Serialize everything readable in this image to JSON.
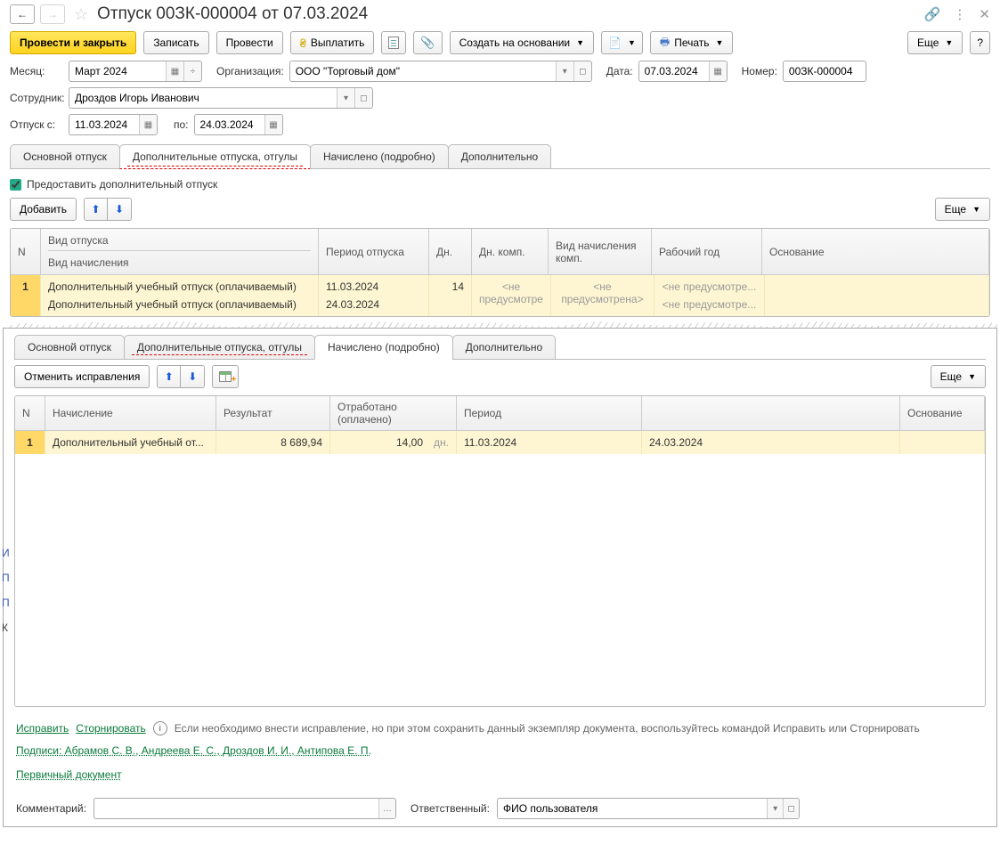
{
  "title": "Отпуск 00ЗК-000004 от 07.03.2024",
  "toolbar": {
    "post_close": "Провести и закрыть",
    "write": "Записать",
    "post": "Провести",
    "payout": "Выплатить",
    "create_based": "Создать на основании",
    "print": "Печать",
    "more": "Еще"
  },
  "form": {
    "month_label": "Месяц:",
    "month_value": "Март 2024",
    "org_label": "Организация:",
    "org_value": "ООО \"Торговый дом\"",
    "date_label": "Дата:",
    "date_value": "07.03.2024",
    "number_label": "Номер:",
    "number_value": "00ЗК-000004",
    "employee_label": "Сотрудник:",
    "employee_value": "Дроздов Игорь Иванович",
    "from_label": "Отпуск с:",
    "from_value": "11.03.2024",
    "to_label": "по:",
    "to_value": "24.03.2024"
  },
  "tabs1": {
    "main": "Основной отпуск",
    "extra": "Дополнительные отпуска, отгулы",
    "accrued": "Начислено (подробно)",
    "addl": "Дополнительно"
  },
  "extra": {
    "checkbox": "Предоставить дополнительный отпуск",
    "add": "Добавить",
    "more": "Еще",
    "head": {
      "n": "N",
      "type": "Вид отпуска",
      "accr_type": "Вид начисления",
      "period": "Период отпуска",
      "days": "Дн.",
      "days_comp": "Дн. комп.",
      "accr_comp": "Вид начисления комп.",
      "work_year": "Рабочий год",
      "basis": "Основание"
    },
    "row": {
      "n": "1",
      "type1": "Дополнительный учебный отпуск (оплачиваемый)",
      "type2": "Дополнительный учебный отпуск (оплачиваемый)",
      "period1": "11.03.2024",
      "period2": "24.03.2024",
      "days": "14",
      "days_comp": "<не предусмотре",
      "accr_comp": "<не предусмотрена>",
      "work_year1": "<не предусмотре...",
      "work_year2": "<не предусмотре..."
    }
  },
  "tabs2": {
    "main": "Основной отпуск",
    "extra": "Дополнительные отпуска, отгулы",
    "accrued": "Начислено (подробно)",
    "addl": "Дополнительно"
  },
  "accrued": {
    "undo": "Отменить исправления",
    "more": "Еще",
    "head": {
      "n": "N",
      "accr": "Начисление",
      "result": "Результат",
      "worked": "Отработано (оплачено)",
      "period": "Период",
      "basis": "Основание"
    },
    "row": {
      "n": "1",
      "accr": "Дополнительный учебный от...",
      "result": "8 689,94",
      "worked_val": "14,00",
      "worked_unit": "дн.",
      "period_from": "11.03.2024",
      "period_to": "24.03.2024"
    }
  },
  "bottom": {
    "fix": "Исправить",
    "storno": "Сторнировать",
    "info": "Если необходимо внести исправление, но при этом сохранить данный экземпляр документа, воспользуйтесь командой Исправить или Сторнировать",
    "sign": "Подписи: Абрамов С. В., Андреева Е. С., Дроздов И. И., Антипова Е. П.",
    "primary": "Первичный документ",
    "comment_label": "Комментарий:",
    "comment_value": "",
    "resp_label": "Ответственный:",
    "resp_value": "ФИО пользователя"
  },
  "sidebar_letters": [
    "И",
    "П",
    "П",
    "К"
  ]
}
